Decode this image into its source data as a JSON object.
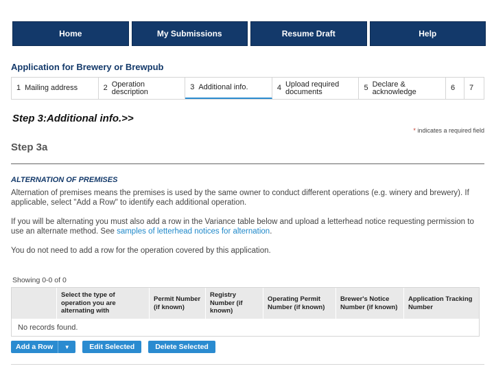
{
  "nav": {
    "items": [
      "Home",
      "My Submissions",
      "Resume Draft",
      "Help"
    ]
  },
  "app_title": "Application for Brewery or Brewpub",
  "steps": [
    {
      "num": "1",
      "label": "Mailing address"
    },
    {
      "num": "2",
      "label": "Operation description"
    },
    {
      "num": "3",
      "label": "Additional info."
    },
    {
      "num": "4",
      "label": "Upload required documents"
    },
    {
      "num": "5",
      "label": "Declare & acknowledge"
    },
    {
      "num": "6",
      "label": ""
    },
    {
      "num": "7",
      "label": ""
    }
  ],
  "active_step": "3",
  "step_heading": "Step 3:Additional info.>>",
  "required_note": {
    "star": "*",
    "text": "indicates a required field"
  },
  "sub_heading": "Step 3a",
  "section": {
    "title": "ALTERNATION OF PREMISES",
    "para1": "Alternation of premises means the premises is used by the same owner to conduct different operations (e.g. winery and brewery). If applicable, select \"Add a Row\" to identify each additional operation.",
    "para2_text": "If you will be alternating you must also add a row in the Variance table below and upload a letterhead notice requesting permission to use an alternate method. See ",
    "para2_link": "samples of letterhead notices for alternation",
    "para2_end": ".",
    "para3": "You do not need to add a row for the operation covered by this application."
  },
  "table": {
    "showing": "Showing 0-0 of 0",
    "headers": [
      "",
      "Select the type of operation you are alternating with",
      "Permit Number (if known)",
      "Registry Number (if known)",
      "Operating Permit Number (if known)",
      "Brewer's Notice Number (if known)",
      "Application Tracking Number"
    ],
    "empty_text": "No records found."
  },
  "buttons": {
    "add_row": "Add a Row",
    "edit": "Edit Selected",
    "delete": "Delete Selected"
  },
  "colors": {
    "nav_bg": "#13396a",
    "accent": "#2a8bd0",
    "link": "#1e88c9"
  }
}
